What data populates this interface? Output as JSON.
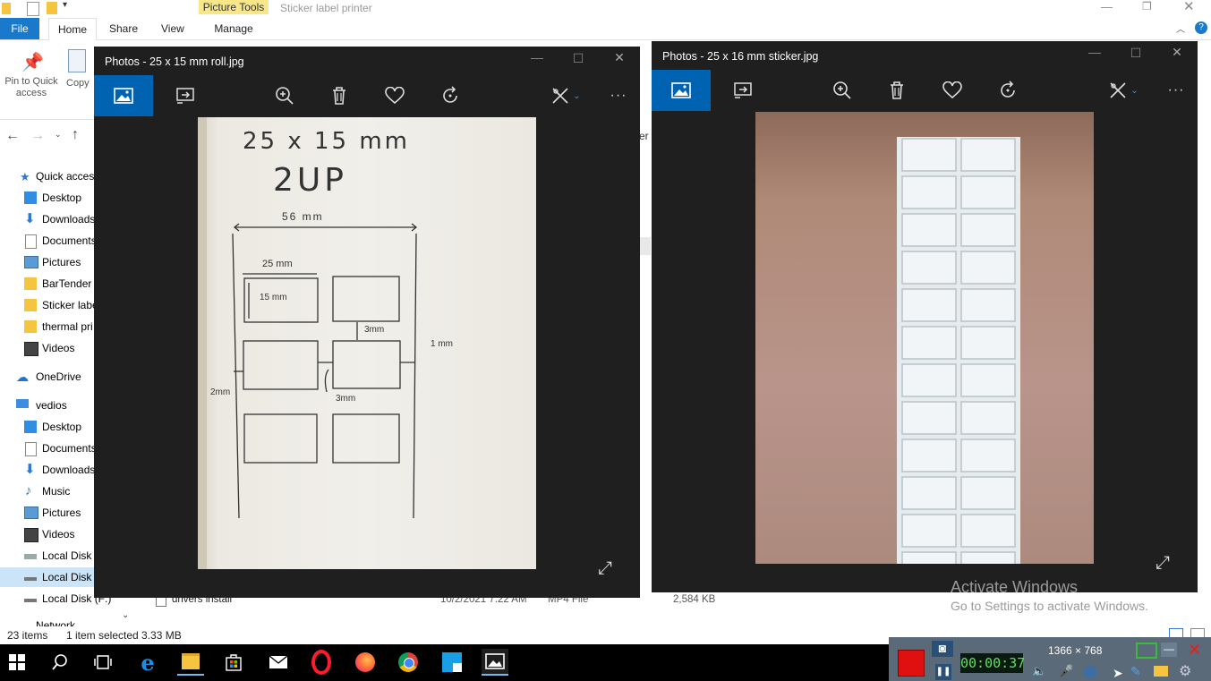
{
  "explorer": {
    "window_title": "Sticker label printer",
    "contextual_group": "Picture Tools",
    "tabs": [
      {
        "label": "File"
      },
      {
        "label": "Home"
      },
      {
        "label": "Share"
      },
      {
        "label": "View"
      },
      {
        "label": "Manage"
      }
    ],
    "ribbon": {
      "pin_label": "Pin to Quick access",
      "copy_label": "Copy"
    },
    "nav_items": [
      {
        "label": "Quick access"
      },
      {
        "label": "Desktop"
      },
      {
        "label": "Downloads"
      },
      {
        "label": "Documents"
      },
      {
        "label": "Pictures"
      },
      {
        "label": "BarTender"
      },
      {
        "label": "Sticker labe"
      },
      {
        "label": "thermal pri"
      },
      {
        "label": "Videos"
      },
      {
        "label": "OneDrive"
      },
      {
        "label": "vedios"
      },
      {
        "label": "Desktop"
      },
      {
        "label": "Documents"
      },
      {
        "label": "Downloads"
      },
      {
        "label": "Music"
      },
      {
        "label": "Pictures"
      },
      {
        "label": "Videos"
      },
      {
        "label": "Local Disk ("
      },
      {
        "label": "Local Disk ("
      },
      {
        "label": "Local Disk (F:)"
      },
      {
        "label": "Network"
      }
    ],
    "partial_text_er": "er",
    "file_row": {
      "name": "drivers install",
      "date": "10/2/2021 7:22 AM",
      "type": "MP4 File",
      "size": "2,584 KB"
    },
    "status": {
      "items": "23 items",
      "selected": "1 item selected  3.33 MB"
    }
  },
  "photo_left": {
    "title": "Photos - 25 x 15 mm roll.jpg",
    "sketch": {
      "heading": "25 x 15 mm",
      "subheading": "2UP",
      "width": "56 mm",
      "label_w": "25 mm",
      "label_h": "15 mm",
      "gap_v": "3mm",
      "gap_h": "3mm",
      "margin_r": "1 mm",
      "margin_l": "2mm"
    }
  },
  "photo_right": {
    "title": "Photos - 25 x 16 mm sticker.jpg"
  },
  "activation": {
    "title": "Activate Windows",
    "subtitle": "Go to Settings to activate Windows."
  },
  "recorder": {
    "timer": "00:00:37",
    "resolution": "1366 × 768"
  },
  "colors": {
    "accent": "#0063b1",
    "file_tab": "#1979ca",
    "photo_bg": "#1f1f1f",
    "context_tab": "#f8e78a"
  }
}
